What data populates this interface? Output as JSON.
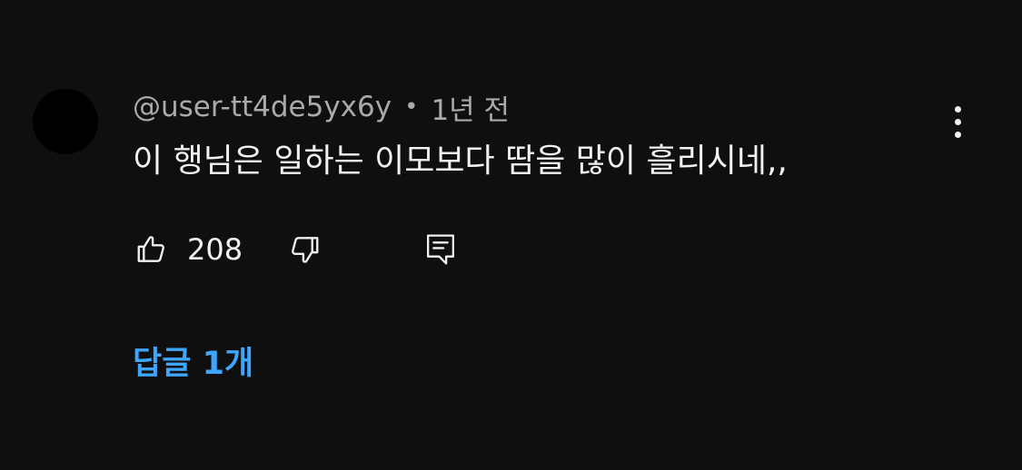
{
  "comment": {
    "author": "@user-tt4de5yx6y",
    "separator": "•",
    "time": "1년 전",
    "text": "이 행님은 일하는 이모보다 땀을 많이 흘리시네,,",
    "like_count": "208",
    "replies_label": "답글 1개"
  },
  "icons": {
    "like": "thumbs-up-icon",
    "dislike": "thumbs-down-icon",
    "reply": "comment-icon",
    "menu": "more-vertical-icon"
  },
  "colors": {
    "background": "#0f0f0f",
    "text": "#f1f1f1",
    "secondary_text": "#aaaaaa",
    "accent": "#3ea6ff"
  }
}
